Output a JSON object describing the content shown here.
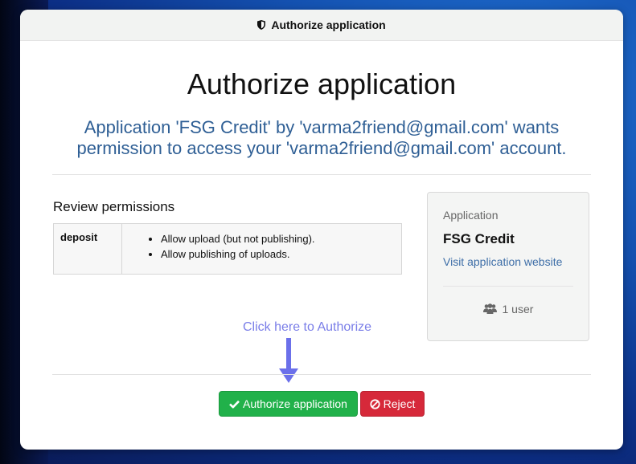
{
  "window": {
    "title": "Authorize application",
    "title_icon": "shield-icon"
  },
  "main": {
    "heading": "Authorize application",
    "subheading_line1": "Application 'FSG Credit' by 'varma2friend@gmail.com' wants",
    "subheading_line2": "permission to access your 'varma2friend@gmail.com' account."
  },
  "permissions": {
    "title": "Review permissions",
    "rows": [
      {
        "scope": "deposit",
        "items": [
          "Allow upload (but not publishing).",
          "Allow publishing of uploads."
        ]
      }
    ]
  },
  "app_panel": {
    "label": "Application",
    "name": "FSG Credit",
    "website_link": "Visit application website",
    "users": "1 user",
    "users_icon": "users-icon"
  },
  "hint": {
    "text": "Click here to Authorize",
    "arrow_icon": "arrow-down-icon"
  },
  "buttons": {
    "authorize_label": "Authorize application",
    "authorize_icon": "check-icon",
    "reject_label": "Reject",
    "reject_icon": "ban-icon"
  },
  "colors": {
    "authorize": "#21b14a",
    "reject": "#d6293a",
    "subheading": "#2f5f95",
    "hint": "#7a7ee8",
    "link": "#3f6fa8"
  }
}
